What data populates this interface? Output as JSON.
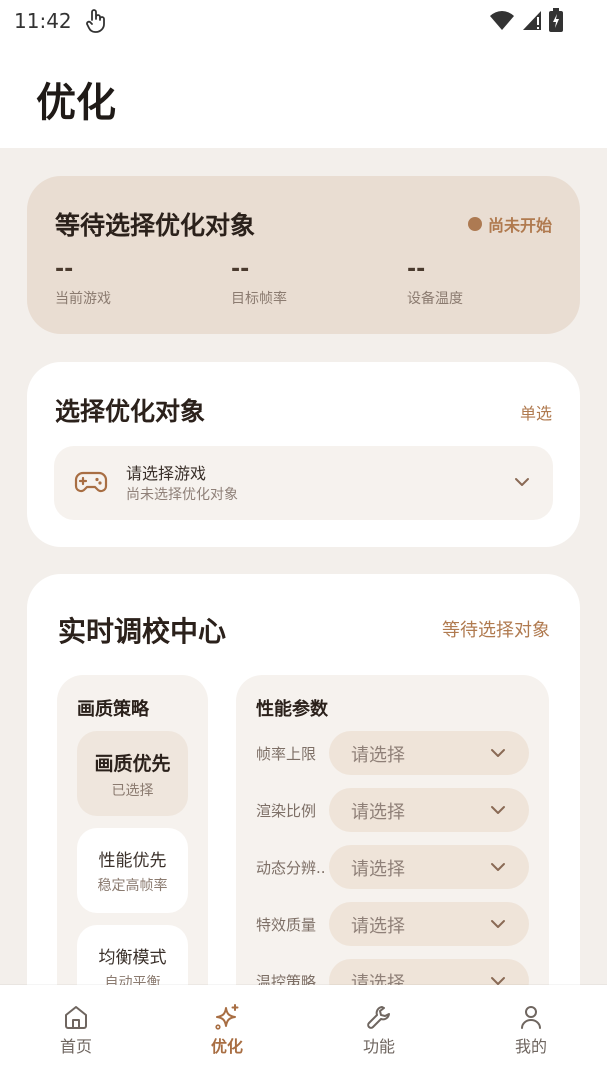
{
  "status_bar": {
    "time": "11:42"
  },
  "header": {
    "title": "优化"
  },
  "status_card": {
    "title": "等待选择优化对象",
    "badge": "尚未开始",
    "metrics": [
      {
        "value": "--",
        "label": "当前游戏"
      },
      {
        "value": "--",
        "label": "目标帧率"
      },
      {
        "value": "--",
        "label": "设备温度"
      }
    ]
  },
  "select_card": {
    "title": "选择优化对象",
    "mode": "单选",
    "picker": {
      "title": "请选择游戏",
      "subtitle": "尚未选择优化对象"
    }
  },
  "tune_card": {
    "title": "实时调校中心",
    "status": "等待选择对象",
    "quality": {
      "title": "画质策略",
      "options": [
        {
          "name": "画质优先",
          "sub": "已选择"
        },
        {
          "name": "性能优先",
          "sub": "稳定高帧率"
        },
        {
          "name": "均衡模式",
          "sub": "自动平衡"
        }
      ]
    },
    "performance": {
      "title": "性能参数",
      "params": [
        {
          "label": "帧率上限",
          "value": "请选择"
        },
        {
          "label": "渲染比例",
          "value": "请选择"
        },
        {
          "label": "动态分辨...",
          "value": "请选择"
        },
        {
          "label": "特效质量",
          "value": "请选择"
        },
        {
          "label": "温控策略",
          "value": "请选择"
        }
      ]
    }
  },
  "bottom_nav": {
    "items": [
      {
        "label": "首页",
        "icon": "home-icon"
      },
      {
        "label": "优化",
        "icon": "sparkle-icon"
      },
      {
        "label": "功能",
        "icon": "wrench-icon"
      },
      {
        "label": "我的",
        "icon": "user-icon"
      }
    ],
    "active": "优化"
  },
  "colors": {
    "accent": "#a86e43",
    "status_card_bg": "#e9ddd2",
    "page_bg": "#f3efeb"
  }
}
